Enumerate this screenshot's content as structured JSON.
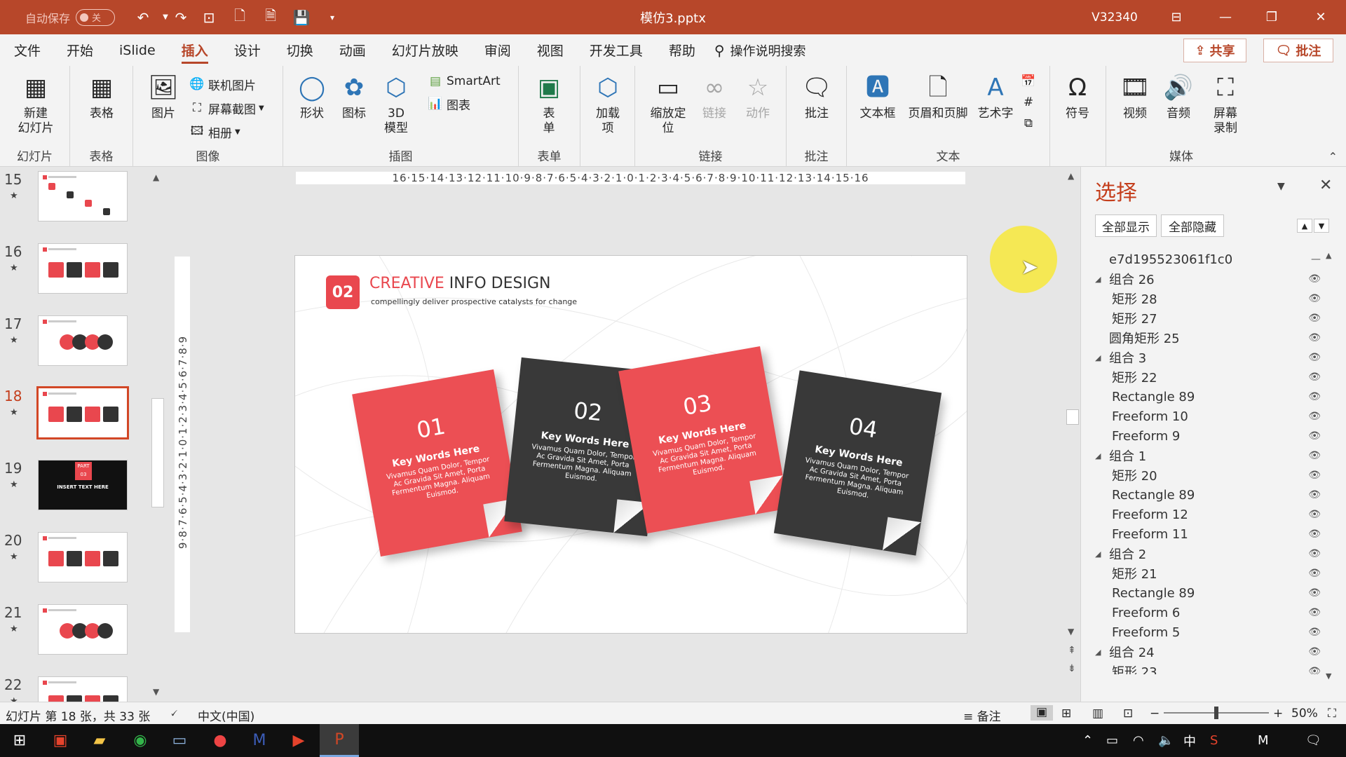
{
  "titlebar": {
    "autosave_label": "自动保存",
    "autosave_state": "关",
    "doc_title": "模仿3.pptx",
    "user": "V32340"
  },
  "tabs": [
    "文件",
    "开始",
    "iSlide",
    "插入",
    "设计",
    "切换",
    "动画",
    "幻灯片放映",
    "审阅",
    "视图",
    "开发工具",
    "帮助"
  ],
  "active_tab": "插入",
  "search_tab": "操作说明搜索",
  "share_label": "共享",
  "comment_label": "批注",
  "ribbon": {
    "slides": {
      "label": "幻灯片",
      "new_slide": "新建\n幻灯片"
    },
    "tables": {
      "label": "表格",
      "table": "表格"
    },
    "images": {
      "label": "图像",
      "picture": "图片",
      "online_picture": "联机图片",
      "screenshot": "屏幕截图",
      "album": "相册"
    },
    "illustrations": {
      "label": "插图",
      "shapes": "形状",
      "icons": "图标",
      "model3d": "3D\n模型",
      "smartart": "SmartArt",
      "chart": "图表"
    },
    "forms": {
      "label": "表单",
      "form": "表\n单"
    },
    "addins": {
      "label": "",
      "addins": "加载\n项"
    },
    "links": {
      "label": "链接",
      "zoom": "缩放定\n位",
      "link": "链接",
      "action": "动作"
    },
    "comments": {
      "label": "批注",
      "comment": "批注"
    },
    "text": {
      "label": "文本",
      "textbox": "文本框",
      "header_footer": "页眉和页脚",
      "wordart": "艺术字"
    },
    "symbols": {
      "label": "",
      "symbol": "符号"
    },
    "media": {
      "label": "媒体",
      "video": "视频",
      "audio": "音频",
      "screen_record": "屏幕\n录制"
    }
  },
  "thumbnails": [
    {
      "num": "15",
      "star": "★"
    },
    {
      "num": "16",
      "star": "★"
    },
    {
      "num": "17",
      "star": "★"
    },
    {
      "num": "18",
      "star": "★",
      "active": true
    },
    {
      "num": "19",
      "star": "★",
      "badge_top": "PART",
      "badge_num": "03",
      "caption": "INSERT TEXT HERE"
    },
    {
      "num": "20",
      "star": "★"
    },
    {
      "num": "21",
      "star": "★"
    },
    {
      "num": "22",
      "star": "★"
    }
  ],
  "hruler": "16·15·14·13·12·11·10·9·8·7·6·5·4·3·2·1·0·1·2·3·4·5·6·7·8·9·10·11·12·13·14·15·16",
  "vruler": "9·8·7·6·5·4·3·2·1·0·1·2·3·4·5·6·7·8·9",
  "slide": {
    "badge": "02",
    "title_red": "CREATIVE",
    "title_rest": " INFO DESIGN",
    "subtitle": "compellingly deliver prospective catalysts for change",
    "cards": [
      {
        "num": "01",
        "keyword": "Key Words Here",
        "desc": "Vivamus Quam Dolor, Tempor Ac Gravida Sit Amet, Porta Fermentum Magna. Aliquam Euismod."
      },
      {
        "num": "02",
        "keyword": "Key Words Here",
        "desc": "Vivamus Quam Dolor, Tempor Ac Gravida Sit Amet, Porta Fermentum Magna. Aliquam Euismod."
      },
      {
        "num": "03",
        "keyword": "Key Words Here",
        "desc": "Vivamus Quam Dolor, Tempor Ac Gravida Sit Amet, Porta Fermentum Magna. Aliquam Euismod."
      },
      {
        "num": "04",
        "keyword": "Key Words Here",
        "desc": "Vivamus Quam Dolor, Tempor Ac Gravida Sit Amet, Porta Fermentum Magna. Aliquam Euismod."
      }
    ]
  },
  "selection_pane": {
    "title": "选择",
    "show_all": "全部显示",
    "hide_all": "全部隐藏",
    "items": [
      {
        "name": "e7d195523061f1c0",
        "level": 0,
        "group": false
      },
      {
        "name": "组合 26",
        "level": 0,
        "group": true
      },
      {
        "name": "矩形 28",
        "level": 1,
        "group": false
      },
      {
        "name": "矩形 27",
        "level": 1,
        "group": false
      },
      {
        "name": "圆角矩形 25",
        "level": 0,
        "group": false
      },
      {
        "name": "组合 3",
        "level": 0,
        "group": true
      },
      {
        "name": "矩形 22",
        "level": 1,
        "group": false
      },
      {
        "name": "Rectangle 89",
        "level": 1,
        "group": false
      },
      {
        "name": "Freeform 10",
        "level": 1,
        "group": false
      },
      {
        "name": "Freeform 9",
        "level": 1,
        "group": false
      },
      {
        "name": "组合 1",
        "level": 0,
        "group": true
      },
      {
        "name": "矩形 20",
        "level": 1,
        "group": false
      },
      {
        "name": "Rectangle 89",
        "level": 1,
        "group": false
      },
      {
        "name": "Freeform 12",
        "level": 1,
        "group": false
      },
      {
        "name": "Freeform 11",
        "level": 1,
        "group": false
      },
      {
        "name": "组合 2",
        "level": 0,
        "group": true
      },
      {
        "name": "矩形 21",
        "level": 1,
        "group": false
      },
      {
        "name": "Rectangle 89",
        "level": 1,
        "group": false
      },
      {
        "name": "Freeform 6",
        "level": 1,
        "group": false
      },
      {
        "name": "Freeform 5",
        "level": 1,
        "group": false
      },
      {
        "name": "组合 24",
        "level": 0,
        "group": true
      },
      {
        "name": "矩形 23",
        "level": 1,
        "group": false
      }
    ]
  },
  "status": {
    "slide_info": "幻灯片 第 18 张，共 33 张",
    "language": "中文(中国)",
    "notes": "备注",
    "zoom": "50%"
  },
  "taskbar": {
    "ime": "中"
  },
  "colors": {
    "accent": "#b7472a",
    "card_red": "#ec4f54",
    "card_dark": "#393939"
  }
}
